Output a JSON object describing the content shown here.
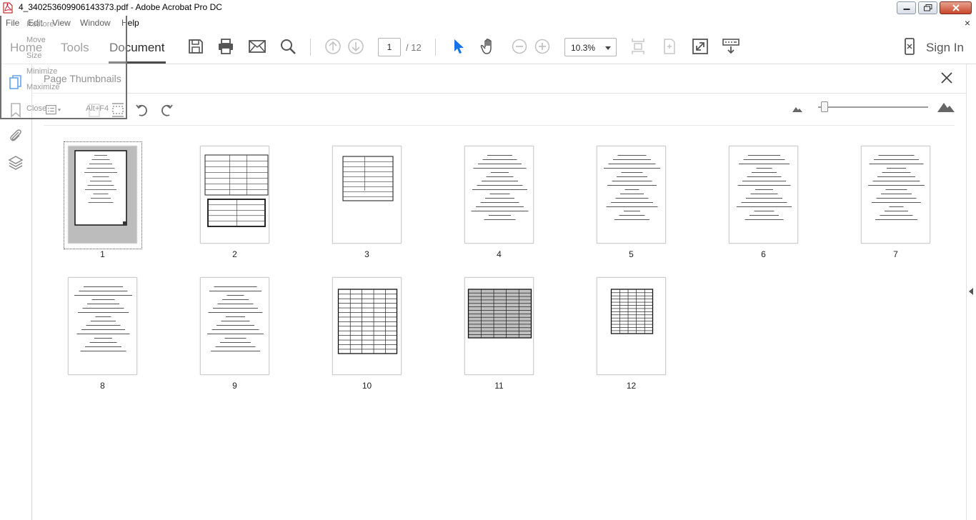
{
  "window": {
    "title": "4_340253609906143373.pdf - Adobe Acrobat Pro DC"
  },
  "menubar": {
    "items": [
      "File",
      "Edit",
      "View",
      "Window",
      "Help"
    ],
    "close_glyph": "×"
  },
  "system_menu": {
    "items": [
      "Restore",
      "Move",
      "Size",
      "Minimize",
      "Maximize",
      "Close"
    ],
    "close_shortcut": "Alt+F4"
  },
  "toolbar": {
    "tabs": [
      "Home",
      "Tools",
      "Document"
    ],
    "active_tab": "Document",
    "page_current": "1",
    "page_total": "/ 12",
    "zoom": "10.3%",
    "sign_in": "Sign In",
    "icons": [
      "save-icon",
      "print-icon",
      "email-icon",
      "search-icon",
      "prev-page-icon",
      "next-page-icon",
      "select-cursor-icon",
      "hand-icon",
      "zoom-out-icon",
      "zoom-in-icon",
      "fit-page-icon",
      "rotate-page-icon",
      "full-screen-icon",
      "read-mode-icon",
      "mobile-link-icon"
    ]
  },
  "colors": {
    "accent": "#1473e6",
    "tab_active": "#2c2c2c",
    "tab_inactive": "#6f6f6f"
  },
  "panel": {
    "title": "Page Thumbnails",
    "tools": [
      "thumbnail-options-icon",
      "insert-page-icon",
      "delete-page-icon",
      "extract-page-icon",
      "rotate-ccw-icon",
      "rotate-cw-icon"
    ],
    "thumbnail_size": 0.05
  },
  "thumbnails": [
    {
      "label": "1",
      "selected": true
    },
    {
      "label": "2",
      "selected": false
    },
    {
      "label": "3",
      "selected": false
    },
    {
      "label": "4",
      "selected": false
    },
    {
      "label": "5",
      "selected": false
    },
    {
      "label": "6",
      "selected": false
    },
    {
      "label": "7",
      "selected": false
    },
    {
      "label": "8",
      "selected": false
    },
    {
      "label": "9",
      "selected": false
    },
    {
      "label": "10",
      "selected": false
    },
    {
      "label": "11",
      "selected": false
    },
    {
      "label": "12",
      "selected": false
    }
  ]
}
